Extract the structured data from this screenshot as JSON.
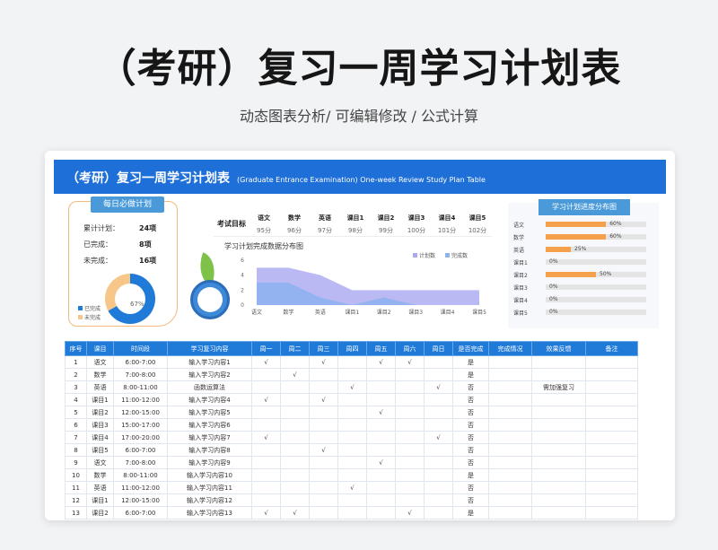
{
  "header": {
    "title": "（考研）复习一周学习计划表",
    "subtitle": "动态图表分析/ 可编辑修改 / 公式计算"
  },
  "banner": {
    "title": "（考研）复习一周学习计划表",
    "english": "(Graduate Entrance Examination) One-week Review Study Plan Table"
  },
  "daily": {
    "tag": "每日必做计划",
    "rows": [
      {
        "label": "累计计划：",
        "value": "24项"
      },
      {
        "label": "已完成：",
        "value": "8项"
      },
      {
        "label": "未完成：",
        "value": "16项"
      }
    ],
    "percent": "67%",
    "legend_done": "已完成",
    "legend_undone": "未完成",
    "colors": {
      "done": "#1f7ad8",
      "undone": "#f7c78a"
    }
  },
  "scores": {
    "label": "考试目标",
    "subjects": [
      {
        "name": "语文",
        "score": "95分"
      },
      {
        "name": "数学",
        "score": "96分"
      },
      {
        "name": "英语",
        "score": "97分"
      },
      {
        "name": "课目1",
        "score": "98分"
      },
      {
        "name": "课目2",
        "score": "99分"
      },
      {
        "name": "课目3",
        "score": "100分"
      },
      {
        "name": "课目4",
        "score": "101分"
      },
      {
        "name": "课目5",
        "score": "102分"
      }
    ]
  },
  "chart_data": {
    "type": "area",
    "title": "学习计划完成数据分布图",
    "categories": [
      "语文",
      "数学",
      "英语",
      "课目1",
      "课目2",
      "课目3",
      "课目4",
      "课目5"
    ],
    "series": [
      {
        "name": "计划数",
        "values": [
          5,
          5,
          4,
          2,
          2,
          2,
          2,
          2
        ],
        "color": "#a9a8f0"
      },
      {
        "name": "完成数",
        "values": [
          3,
          3,
          1,
          0,
          1,
          0,
          0,
          0
        ],
        "color": "#8fb3ef"
      }
    ],
    "ylim": [
      0,
      6
    ],
    "yticks": [
      0,
      2,
      4,
      6
    ],
    "legend": "top-right",
    "grid": false
  },
  "progress": {
    "tag": "学习计划进度分布图",
    "rows": [
      {
        "name": "语文",
        "value": 0.6,
        "label": "60%"
      },
      {
        "name": "数学",
        "value": 0.6,
        "label": "60%"
      },
      {
        "name": "英语",
        "value": 0.25,
        "label": "25%"
      },
      {
        "name": "课目1",
        "value": 0,
        "label": "0%"
      },
      {
        "name": "课目2",
        "value": 0.5,
        "label": "50%"
      },
      {
        "name": "课目3",
        "value": 0,
        "label": "0%"
      },
      {
        "name": "课目4",
        "value": 0,
        "label": "0%"
      },
      {
        "name": "课目5",
        "value": 0,
        "label": "0%"
      }
    ],
    "color": "#f5a04a"
  },
  "table": {
    "columns": [
      "序号",
      "课目",
      "时间段",
      "学习复习内容",
      "周一",
      "周二",
      "周三",
      "周四",
      "周五",
      "周六",
      "周日",
      "是否完成",
      "完成情况",
      "效果反馈",
      "备注"
    ],
    "rows": [
      [
        "1",
        "语文",
        "6:00-7:00",
        "输入学习内容1",
        "√",
        "",
        "√",
        "",
        "√",
        "√",
        "",
        "是",
        "",
        "",
        ""
      ],
      [
        "2",
        "数学",
        "7:00-8:00",
        "输入学习内容2",
        "",
        "√",
        "",
        "",
        "",
        "",
        "",
        "是",
        "",
        "",
        ""
      ],
      [
        "3",
        "英语",
        "8:00-11:00",
        "函数运算法",
        "",
        "",
        "",
        "√",
        "",
        "",
        "√",
        "否",
        "",
        "需加强复习",
        ""
      ],
      [
        "4",
        "课目1",
        "11:00-12:00",
        "输入学习内容4",
        "√",
        "",
        "√",
        "",
        "",
        "",
        "",
        "否",
        "",
        "",
        ""
      ],
      [
        "5",
        "课目2",
        "12:00-15:00",
        "输入学习内容5",
        "",
        "",
        "",
        "",
        "√",
        "",
        "",
        "否",
        "",
        "",
        ""
      ],
      [
        "6",
        "课目3",
        "15:00-17:00",
        "输入学习内容6",
        "",
        "",
        "",
        "",
        "",
        "",
        "",
        "否",
        "",
        "",
        ""
      ],
      [
        "7",
        "课目4",
        "17:00-20:00",
        "输入学习内容7",
        "√",
        "",
        "",
        "",
        "",
        "",
        "√",
        "否",
        "",
        "",
        ""
      ],
      [
        "8",
        "课目5",
        "6:00-7:00",
        "输入学习内容8",
        "",
        "",
        "√",
        "",
        "",
        "",
        "",
        "否",
        "",
        "",
        ""
      ],
      [
        "9",
        "语文",
        "7:00-8:00",
        "输入学习内容9",
        "",
        "",
        "",
        "",
        "√",
        "",
        "",
        "否",
        "",
        "",
        ""
      ],
      [
        "10",
        "数学",
        "8:00-11:00",
        "输入学习内容10",
        "",
        "",
        "",
        "",
        "",
        "",
        "",
        "是",
        "",
        "",
        ""
      ],
      [
        "11",
        "英语",
        "11:00-12:00",
        "输入学习内容11",
        "",
        "",
        "",
        "√",
        "",
        "",
        "",
        "否",
        "",
        "",
        ""
      ],
      [
        "12",
        "课目1",
        "12:00-15:00",
        "输入学习内容12",
        "",
        "",
        "",
        "",
        "",
        "",
        "",
        "否",
        "",
        "",
        ""
      ],
      [
        "13",
        "课目2",
        "6:00-7:00",
        "输入学习内容13",
        "√",
        "√",
        "",
        "",
        "",
        "√",
        "",
        "是",
        "",
        "",
        ""
      ]
    ]
  }
}
